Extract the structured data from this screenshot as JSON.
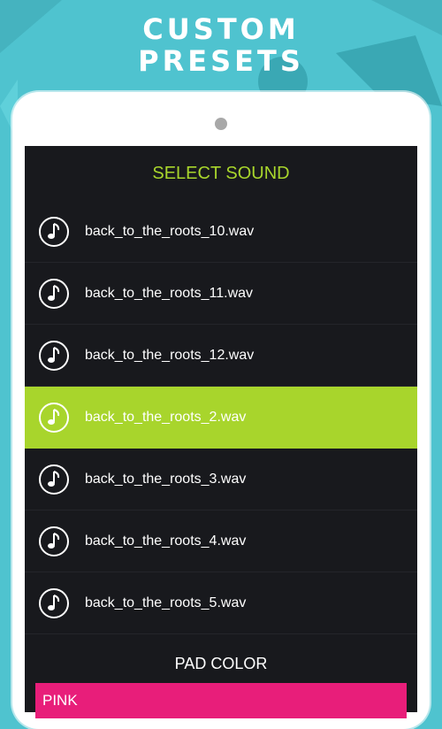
{
  "promo": {
    "headline_line1": "CUSTOM",
    "headline_line2": "PRESETS"
  },
  "dialog": {
    "title": "SELECT SOUND",
    "sounds": [
      {
        "label": "back_to_the_roots_10.wav",
        "selected": false
      },
      {
        "label": "back_to_the_roots_11.wav",
        "selected": false
      },
      {
        "label": "back_to_the_roots_12.wav",
        "selected": false
      },
      {
        "label": "back_to_the_roots_2.wav",
        "selected": true
      },
      {
        "label": "back_to_the_roots_3.wav",
        "selected": false
      },
      {
        "label": "back_to_the_roots_4.wav",
        "selected": false
      },
      {
        "label": "back_to_the_roots_5.wav",
        "selected": false
      }
    ],
    "pad_color_title": "PAD COLOR",
    "pad_color_option": "PINK"
  },
  "colors": {
    "background": "#4fc3cf",
    "accent_green": "#a8d52c",
    "panel": "#18191d",
    "pink": "#e81e7a"
  },
  "icons": {
    "sound_item": "music-note-icon"
  }
}
